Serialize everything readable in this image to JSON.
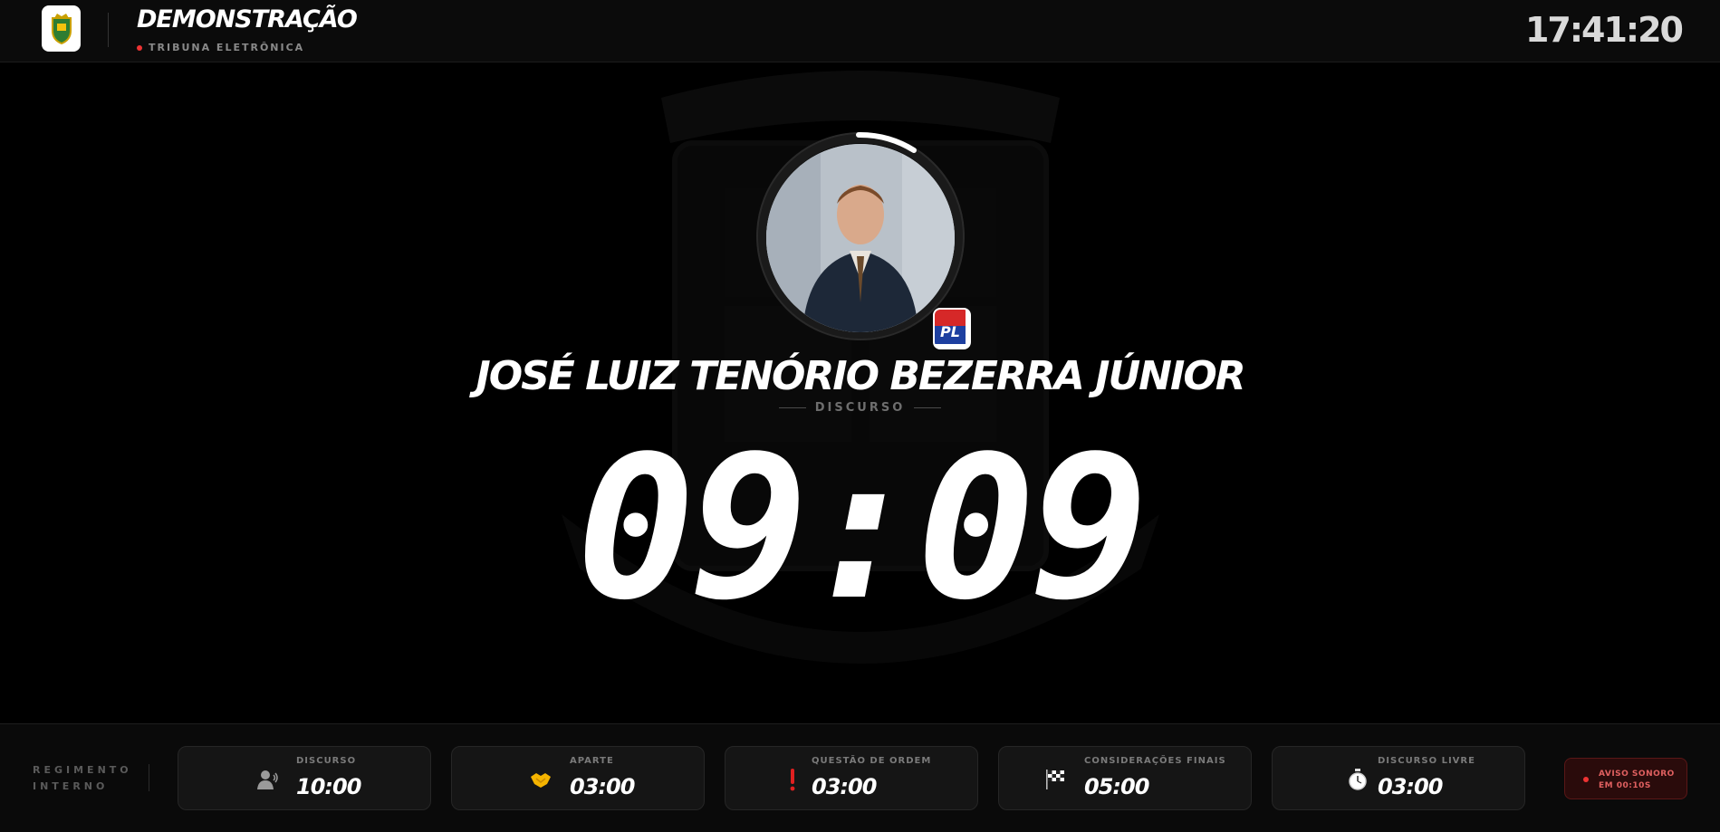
{
  "header": {
    "title": "DEMONSTRAÇÃO",
    "subtitle": "TRIBUNA ELETRÔNICA",
    "clock": "17:41:20"
  },
  "speaker": {
    "name": "JOSÉ LUIZ TENÓRIO BEZERRA JÚNIOR",
    "party": "PL",
    "mode": "DISCURSO",
    "timer": "09:09"
  },
  "footer": {
    "section_label_line1": "REGIMENTO",
    "section_label_line2": "INTERNO",
    "cards": [
      {
        "label": "DISCURSO",
        "value": "10:00",
        "icon": "speaker-person-icon"
      },
      {
        "label": "APARTE",
        "value": "03:00",
        "icon": "handshake-icon"
      },
      {
        "label": "QUESTÃO DE ORDEM",
        "value": "03:00",
        "icon": "exclamation-icon"
      },
      {
        "label": "CONSIDERAÇÕES FINAIS",
        "value": "05:00",
        "icon": "checkered-flag-icon"
      },
      {
        "label": "DISCURSO LIVRE",
        "value": "03:00",
        "icon": "stopwatch-icon"
      }
    ],
    "alert_line1": "AVISO SONORO",
    "alert_line2": "EM 00:10S"
  },
  "colors": {
    "background": "#000000",
    "accent_red": "#e33333",
    "card_bg": "#151515"
  }
}
